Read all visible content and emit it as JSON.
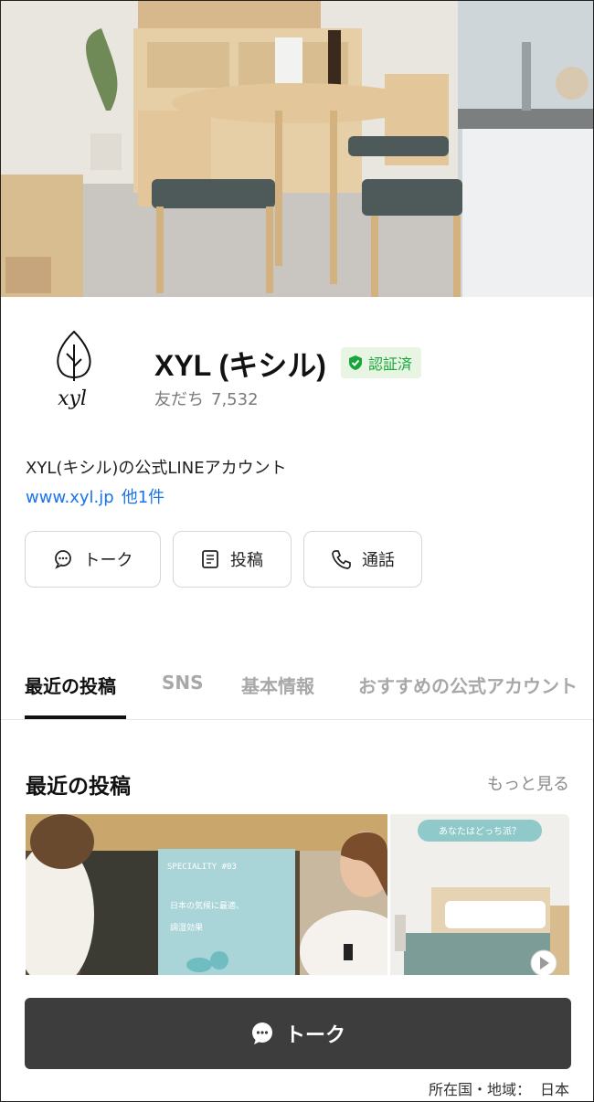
{
  "profile": {
    "name": "XYL (キシル)",
    "verified_label": "認証済",
    "friends_label": "友だち",
    "friends_count": "7,532",
    "description": "XYL(キシル)の公式LINEアカウント",
    "website": "www.xyl.jp",
    "website_more": "他1件",
    "logo_text": "xyl"
  },
  "actions": [
    {
      "label": "トーク",
      "icon": "chat-bubble-icon"
    },
    {
      "label": "投稿",
      "icon": "document-icon"
    },
    {
      "label": "通話",
      "icon": "phone-icon"
    }
  ],
  "tabs": [
    {
      "label": "最近の投稿",
      "active": true
    },
    {
      "label": "SNS",
      "active": false
    },
    {
      "label": "基本情報",
      "active": false
    },
    {
      "label": "おすすめの公式アカウント",
      "active": false
    }
  ],
  "recent_posts": {
    "title": "最近の投稿",
    "see_more": "もっと見る",
    "posts": [
      {
        "sign_line1": "SPECIALITY #03",
        "sign_line2": "日本の気候に最適、",
        "sign_line3": "調湿効果",
        "icon": "video-post"
      },
      {
        "caption": "あなたはどっち派？",
        "icon": "play-icon"
      }
    ]
  },
  "cta": {
    "label": "トーク",
    "icon": "chat-bubble-icon"
  },
  "footer": {
    "label": "所在国・地域：",
    "value": "日本"
  },
  "colors": {
    "verified_green": "#17a63a",
    "link_blue": "#1a73e8",
    "cta_bg": "#3d3d3d"
  }
}
